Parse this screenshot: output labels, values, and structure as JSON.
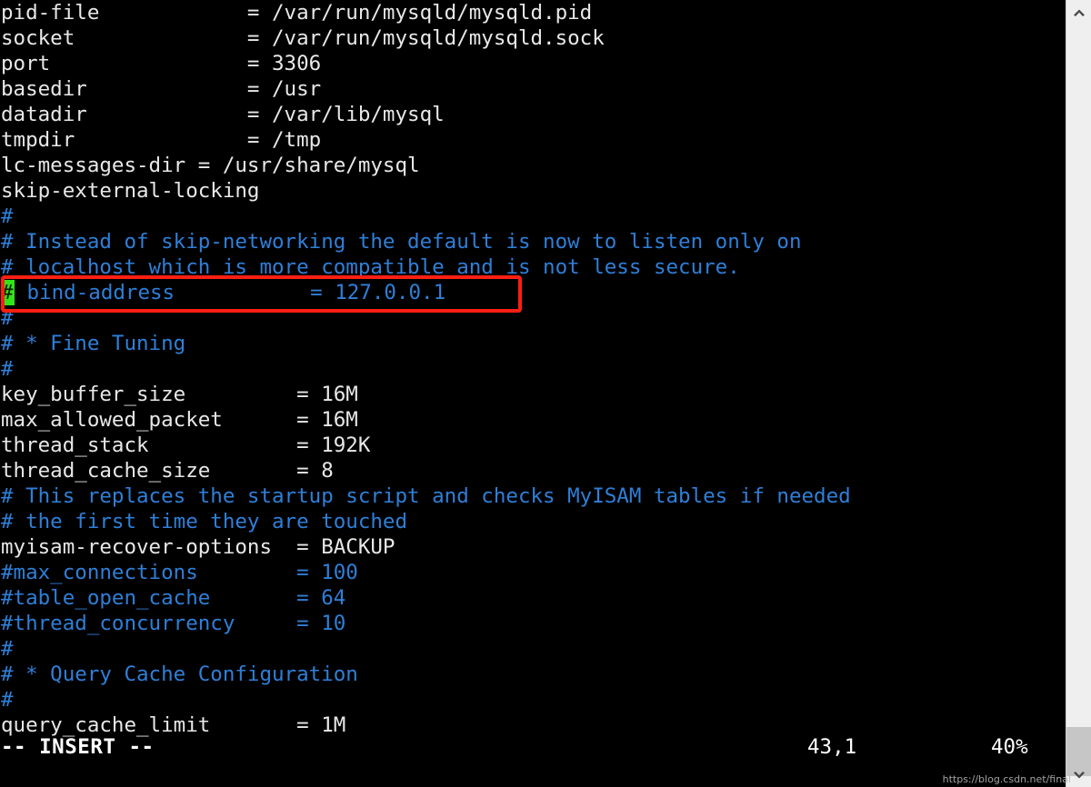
{
  "editor": {
    "name": "vim",
    "filetype": "mysql-config",
    "background": "#000000",
    "foreground": "#f0f0f0",
    "comment_color": "#2f7fd8",
    "cursor_color": "#31e31a",
    "lines": [
      {
        "id": 1,
        "segments": [
          {
            "text": "pid-file            = /var/run/mysqld/mysqld.pid",
            "style": "text"
          }
        ]
      },
      {
        "id": 2,
        "segments": [
          {
            "text": "socket              = /var/run/mysqld/mysqld.sock",
            "style": "text"
          }
        ]
      },
      {
        "id": 3,
        "segments": [
          {
            "text": "port                = 3306",
            "style": "text"
          }
        ]
      },
      {
        "id": 4,
        "segments": [
          {
            "text": "basedir             = /usr",
            "style": "text"
          }
        ]
      },
      {
        "id": 5,
        "segments": [
          {
            "text": "datadir             = /var/lib/mysql",
            "style": "text"
          }
        ]
      },
      {
        "id": 6,
        "segments": [
          {
            "text": "tmpdir              = /tmp",
            "style": "text"
          }
        ]
      },
      {
        "id": 7,
        "segments": [
          {
            "text": "lc-messages-dir = /usr/share/mysql",
            "style": "text"
          }
        ]
      },
      {
        "id": 8,
        "segments": [
          {
            "text": "skip-external-locking",
            "style": "text"
          }
        ]
      },
      {
        "id": 9,
        "segments": [
          {
            "text": "#",
            "style": "comment"
          }
        ]
      },
      {
        "id": 10,
        "segments": [
          {
            "text": "# Instead of skip-networking the default is now to listen only on",
            "style": "comment"
          }
        ]
      },
      {
        "id": 11,
        "segments": [
          {
            "text": "# localhost which is more compatible and is not less secure.",
            "style": "comment"
          }
        ]
      },
      {
        "id": 12,
        "cursor": "#",
        "segments": [
          {
            "text": " bind-address           = 127.0.0.1",
            "style": "comment"
          }
        ]
      },
      {
        "id": 13,
        "segments": [
          {
            "text": "#",
            "style": "comment"
          }
        ]
      },
      {
        "id": 14,
        "segments": [
          {
            "text": "# * Fine Tuning",
            "style": "comment"
          }
        ]
      },
      {
        "id": 15,
        "segments": [
          {
            "text": "#",
            "style": "comment"
          }
        ]
      },
      {
        "id": 16,
        "segments": [
          {
            "text": "key_buffer_size         = 16M",
            "style": "text"
          }
        ]
      },
      {
        "id": 17,
        "segments": [
          {
            "text": "max_allowed_packet      = 16M",
            "style": "text"
          }
        ]
      },
      {
        "id": 18,
        "segments": [
          {
            "text": "thread_stack            = 192K",
            "style": "text"
          }
        ]
      },
      {
        "id": 19,
        "segments": [
          {
            "text": "thread_cache_size       = 8",
            "style": "text"
          }
        ]
      },
      {
        "id": 20,
        "segments": [
          {
            "text": "# This replaces the startup script and checks MyISAM tables if needed",
            "style": "comment"
          }
        ]
      },
      {
        "id": 21,
        "segments": [
          {
            "text": "# the first time they are touched",
            "style": "comment"
          }
        ]
      },
      {
        "id": 22,
        "segments": [
          {
            "text": "myisam-recover-options  = BACKUP",
            "style": "text"
          }
        ]
      },
      {
        "id": 23,
        "segments": [
          {
            "text": "#max_connections        = 100",
            "style": "comment"
          }
        ]
      },
      {
        "id": 24,
        "segments": [
          {
            "text": "#table_open_cache       = 64",
            "style": "comment"
          }
        ]
      },
      {
        "id": 25,
        "segments": [
          {
            "text": "#thread_concurrency     = 10",
            "style": "comment"
          }
        ]
      },
      {
        "id": 26,
        "segments": [
          {
            "text": "#",
            "style": "comment"
          }
        ]
      },
      {
        "id": 27,
        "segments": [
          {
            "text": "# * Query Cache Configuration",
            "style": "comment"
          }
        ]
      },
      {
        "id": 28,
        "segments": [
          {
            "text": "#",
            "style": "comment"
          }
        ]
      },
      {
        "id": 29,
        "segments": [
          {
            "text": "query_cache_limit       = 1M",
            "style": "text"
          }
        ]
      }
    ]
  },
  "statusline": {
    "mode": "-- INSERT --",
    "position": "43,1",
    "percent": "40%"
  },
  "annotation": {
    "type": "rectangle-highlight",
    "color": "#fc1f12",
    "target_line": "# bind-address           = 127.0.0.1"
  },
  "scrollbar": {
    "up_icon": "chevron-up-icon",
    "down_icon": "chevron-down-icon",
    "thumb_position": "bottom",
    "track_color": "#efefef",
    "thumb_color": "#c6c6c6"
  },
  "watermark": {
    "text": "https://blog.csdn.net/final"
  }
}
